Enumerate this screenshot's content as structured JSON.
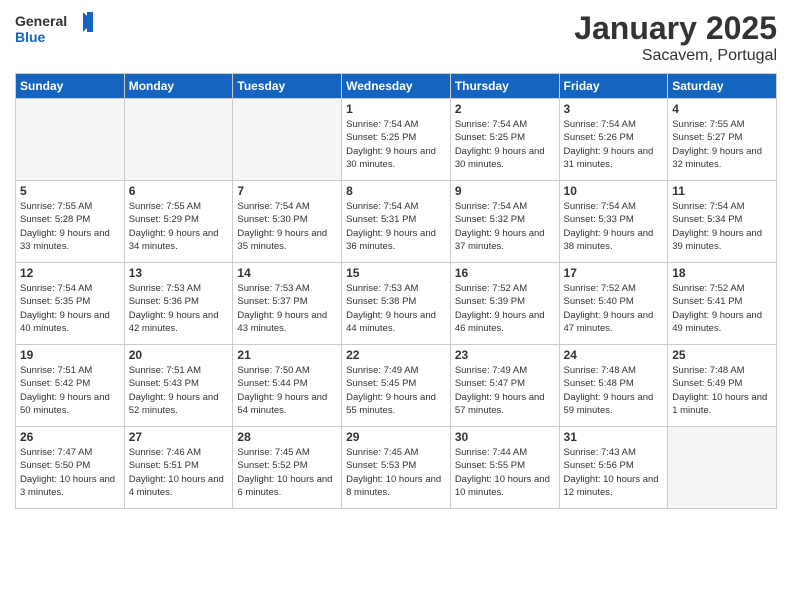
{
  "header": {
    "logo_general": "General",
    "logo_blue": "Blue",
    "month_year": "January 2025",
    "location": "Sacavem, Portugal"
  },
  "weekdays": [
    "Sunday",
    "Monday",
    "Tuesday",
    "Wednesday",
    "Thursday",
    "Friday",
    "Saturday"
  ],
  "weeks": [
    [
      {
        "day": "",
        "sunrise": "",
        "sunset": "",
        "daylight": "",
        "empty": true
      },
      {
        "day": "",
        "sunrise": "",
        "sunset": "",
        "daylight": "",
        "empty": true
      },
      {
        "day": "",
        "sunrise": "",
        "sunset": "",
        "daylight": "",
        "empty": true
      },
      {
        "day": "1",
        "sunrise": "Sunrise: 7:54 AM",
        "sunset": "Sunset: 5:25 PM",
        "daylight": "Daylight: 9 hours and 30 minutes.",
        "empty": false
      },
      {
        "day": "2",
        "sunrise": "Sunrise: 7:54 AM",
        "sunset": "Sunset: 5:25 PM",
        "daylight": "Daylight: 9 hours and 30 minutes.",
        "empty": false
      },
      {
        "day": "3",
        "sunrise": "Sunrise: 7:54 AM",
        "sunset": "Sunset: 5:26 PM",
        "daylight": "Daylight: 9 hours and 31 minutes.",
        "empty": false
      },
      {
        "day": "4",
        "sunrise": "Sunrise: 7:55 AM",
        "sunset": "Sunset: 5:27 PM",
        "daylight": "Daylight: 9 hours and 32 minutes.",
        "empty": false
      }
    ],
    [
      {
        "day": "5",
        "sunrise": "Sunrise: 7:55 AM",
        "sunset": "Sunset: 5:28 PM",
        "daylight": "Daylight: 9 hours and 33 minutes.",
        "empty": false
      },
      {
        "day": "6",
        "sunrise": "Sunrise: 7:55 AM",
        "sunset": "Sunset: 5:29 PM",
        "daylight": "Daylight: 9 hours and 34 minutes.",
        "empty": false
      },
      {
        "day": "7",
        "sunrise": "Sunrise: 7:54 AM",
        "sunset": "Sunset: 5:30 PM",
        "daylight": "Daylight: 9 hours and 35 minutes.",
        "empty": false
      },
      {
        "day": "8",
        "sunrise": "Sunrise: 7:54 AM",
        "sunset": "Sunset: 5:31 PM",
        "daylight": "Daylight: 9 hours and 36 minutes.",
        "empty": false
      },
      {
        "day": "9",
        "sunrise": "Sunrise: 7:54 AM",
        "sunset": "Sunset: 5:32 PM",
        "daylight": "Daylight: 9 hours and 37 minutes.",
        "empty": false
      },
      {
        "day": "10",
        "sunrise": "Sunrise: 7:54 AM",
        "sunset": "Sunset: 5:33 PM",
        "daylight": "Daylight: 9 hours and 38 minutes.",
        "empty": false
      },
      {
        "day": "11",
        "sunrise": "Sunrise: 7:54 AM",
        "sunset": "Sunset: 5:34 PM",
        "daylight": "Daylight: 9 hours and 39 minutes.",
        "empty": false
      }
    ],
    [
      {
        "day": "12",
        "sunrise": "Sunrise: 7:54 AM",
        "sunset": "Sunset: 5:35 PM",
        "daylight": "Daylight: 9 hours and 40 minutes.",
        "empty": false
      },
      {
        "day": "13",
        "sunrise": "Sunrise: 7:53 AM",
        "sunset": "Sunset: 5:36 PM",
        "daylight": "Daylight: 9 hours and 42 minutes.",
        "empty": false
      },
      {
        "day": "14",
        "sunrise": "Sunrise: 7:53 AM",
        "sunset": "Sunset: 5:37 PM",
        "daylight": "Daylight: 9 hours and 43 minutes.",
        "empty": false
      },
      {
        "day": "15",
        "sunrise": "Sunrise: 7:53 AM",
        "sunset": "Sunset: 5:38 PM",
        "daylight": "Daylight: 9 hours and 44 minutes.",
        "empty": false
      },
      {
        "day": "16",
        "sunrise": "Sunrise: 7:52 AM",
        "sunset": "Sunset: 5:39 PM",
        "daylight": "Daylight: 9 hours and 46 minutes.",
        "empty": false
      },
      {
        "day": "17",
        "sunrise": "Sunrise: 7:52 AM",
        "sunset": "Sunset: 5:40 PM",
        "daylight": "Daylight: 9 hours and 47 minutes.",
        "empty": false
      },
      {
        "day": "18",
        "sunrise": "Sunrise: 7:52 AM",
        "sunset": "Sunset: 5:41 PM",
        "daylight": "Daylight: 9 hours and 49 minutes.",
        "empty": false
      }
    ],
    [
      {
        "day": "19",
        "sunrise": "Sunrise: 7:51 AM",
        "sunset": "Sunset: 5:42 PM",
        "daylight": "Daylight: 9 hours and 50 minutes.",
        "empty": false
      },
      {
        "day": "20",
        "sunrise": "Sunrise: 7:51 AM",
        "sunset": "Sunset: 5:43 PM",
        "daylight": "Daylight: 9 hours and 52 minutes.",
        "empty": false
      },
      {
        "day": "21",
        "sunrise": "Sunrise: 7:50 AM",
        "sunset": "Sunset: 5:44 PM",
        "daylight": "Daylight: 9 hours and 54 minutes.",
        "empty": false
      },
      {
        "day": "22",
        "sunrise": "Sunrise: 7:49 AM",
        "sunset": "Sunset: 5:45 PM",
        "daylight": "Daylight: 9 hours and 55 minutes.",
        "empty": false
      },
      {
        "day": "23",
        "sunrise": "Sunrise: 7:49 AM",
        "sunset": "Sunset: 5:47 PM",
        "daylight": "Daylight: 9 hours and 57 minutes.",
        "empty": false
      },
      {
        "day": "24",
        "sunrise": "Sunrise: 7:48 AM",
        "sunset": "Sunset: 5:48 PM",
        "daylight": "Daylight: 9 hours and 59 minutes.",
        "empty": false
      },
      {
        "day": "25",
        "sunrise": "Sunrise: 7:48 AM",
        "sunset": "Sunset: 5:49 PM",
        "daylight": "Daylight: 10 hours and 1 minute.",
        "empty": false
      }
    ],
    [
      {
        "day": "26",
        "sunrise": "Sunrise: 7:47 AM",
        "sunset": "Sunset: 5:50 PM",
        "daylight": "Daylight: 10 hours and 3 minutes.",
        "empty": false
      },
      {
        "day": "27",
        "sunrise": "Sunrise: 7:46 AM",
        "sunset": "Sunset: 5:51 PM",
        "daylight": "Daylight: 10 hours and 4 minutes.",
        "empty": false
      },
      {
        "day": "28",
        "sunrise": "Sunrise: 7:45 AM",
        "sunset": "Sunset: 5:52 PM",
        "daylight": "Daylight: 10 hours and 6 minutes.",
        "empty": false
      },
      {
        "day": "29",
        "sunrise": "Sunrise: 7:45 AM",
        "sunset": "Sunset: 5:53 PM",
        "daylight": "Daylight: 10 hours and 8 minutes.",
        "empty": false
      },
      {
        "day": "30",
        "sunrise": "Sunrise: 7:44 AM",
        "sunset": "Sunset: 5:55 PM",
        "daylight": "Daylight: 10 hours and 10 minutes.",
        "empty": false
      },
      {
        "day": "31",
        "sunrise": "Sunrise: 7:43 AM",
        "sunset": "Sunset: 5:56 PM",
        "daylight": "Daylight: 10 hours and 12 minutes.",
        "empty": false
      },
      {
        "day": "",
        "sunrise": "",
        "sunset": "",
        "daylight": "",
        "empty": true
      }
    ]
  ]
}
